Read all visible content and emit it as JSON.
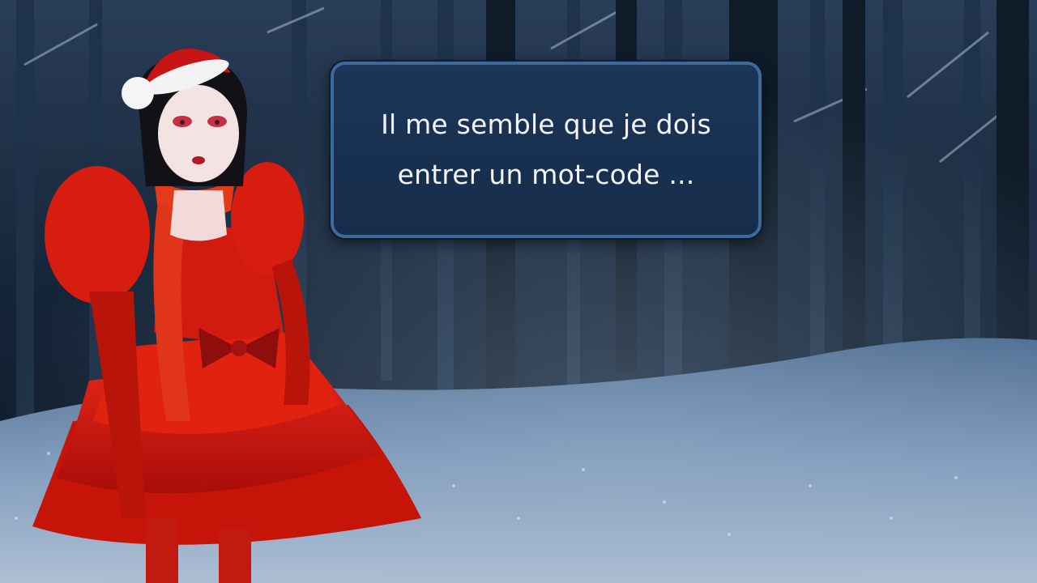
{
  "dialog": {
    "text": "Il me semble que je dois entrer un mot-code ..."
  },
  "scene": {
    "background": "snowy-night-forest",
    "character": "woman-in-red-dress-with-santa-hat"
  },
  "colors": {
    "dialog_bg": "#1b3658",
    "dialog_border": "#3d6a9a",
    "dialog_text": "#f2f4f8",
    "dress_red": "#d81a10",
    "snow": "#c9d6e6"
  }
}
